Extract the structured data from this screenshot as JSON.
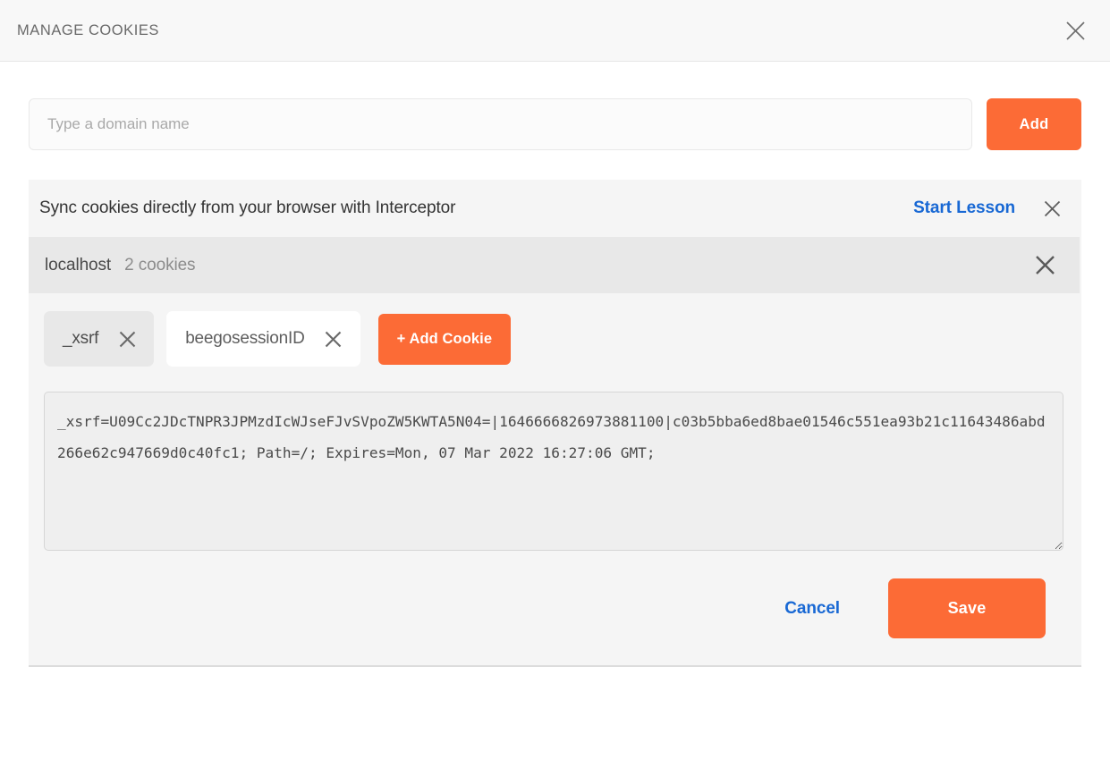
{
  "header": {
    "title": "MANAGE COOKIES",
    "close_icon": "close-icon"
  },
  "domain_add": {
    "placeholder": "Type a domain name",
    "value": "",
    "add_label": "Add"
  },
  "interceptor_banner": {
    "text": "Sync cookies directly from your browser with Interceptor",
    "link_label": "Start Lesson",
    "close_icon": "close-icon"
  },
  "domain_group": {
    "name": "localhost",
    "cookie_count": "2 cookies",
    "close_icon": "close-icon",
    "cookies": [
      {
        "name": "_xsrf",
        "selected": true
      },
      {
        "name": "beegosessionID",
        "selected": false
      }
    ],
    "add_cookie_label": "+ Add Cookie",
    "cookie_value": "_xsrf=U09Cc2JDcTNPR3JPMzdIcWJseFJvSVpoZW5KWTA5N04=|1646666826973881100|c03b5bba6ed8bae01546c551ea93b21c11643486abd266e62c947669d0c40fc1; Path=/; Expires=Mon, 07 Mar 2022 16:27:06 GMT;"
  },
  "footer": {
    "cancel_label": "Cancel",
    "save_label": "Save"
  },
  "colors": {
    "accent_orange": "#fc6b36",
    "link_blue": "#1868d4",
    "panel_bg": "#f5f5f5",
    "domain_bar_bg": "#e8e8e8"
  }
}
